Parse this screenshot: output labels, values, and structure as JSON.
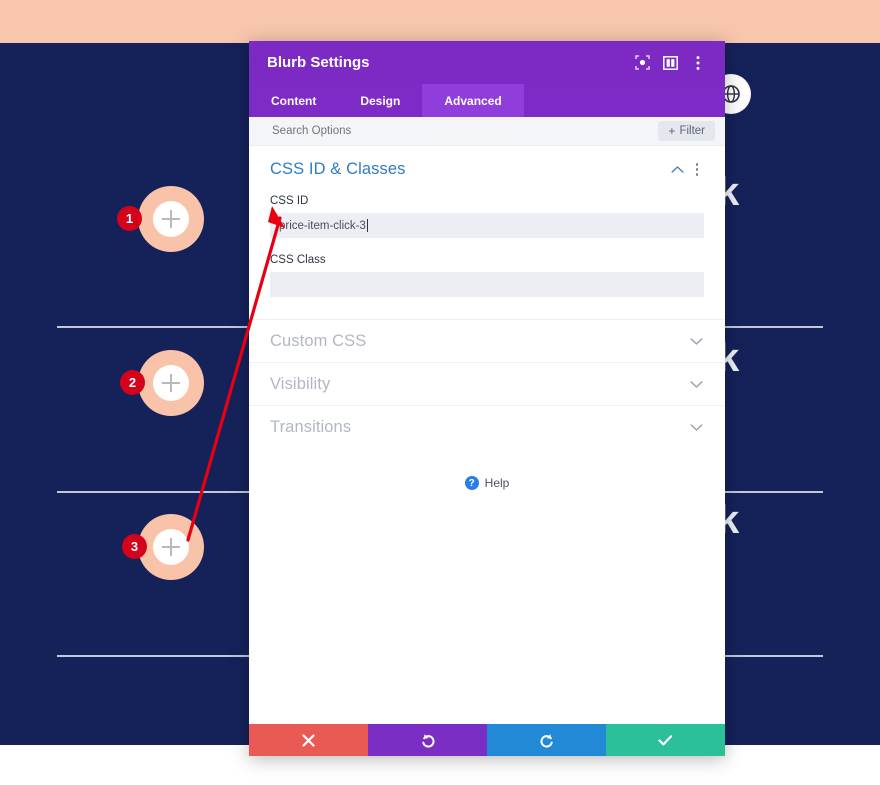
{
  "background": {
    "band_color": "#f7c6ad",
    "page_color": "#15225a",
    "globe_icon": "globe-icon",
    "blurbs": [
      {
        "number": "1",
        "icon": "plus-icon",
        "text_fragment": "k"
      },
      {
        "number": "2",
        "icon": "plus-icon",
        "text_fragment": "k"
      },
      {
        "number": "3",
        "icon": "plus-icon",
        "text_fragment": "k"
      }
    ]
  },
  "modal": {
    "title": "Blurb Settings",
    "header_icons": [
      {
        "name": "focus-target-icon"
      },
      {
        "name": "panel-layout-icon"
      },
      {
        "name": "more-options-icon"
      }
    ],
    "tabs": [
      {
        "label": "Content",
        "active": false
      },
      {
        "label": "Design",
        "active": false
      },
      {
        "label": "Advanced",
        "active": true
      }
    ],
    "search": {
      "placeholder": "Search Options",
      "value": ""
    },
    "filter_button": {
      "label": "Filter",
      "plus": "+"
    },
    "open_section": {
      "title": "CSS ID & Classes",
      "collapse_icon": "chevron-up-icon",
      "menu_icon": "more-options-icon",
      "fields": [
        {
          "label": "CSS ID",
          "value": "price-item-click-3",
          "focused": true
        },
        {
          "label": "CSS Class",
          "value": "",
          "focused": false
        }
      ]
    },
    "collapsed_sections": [
      {
        "title": "Custom CSS",
        "icon": "chevron-down-icon"
      },
      {
        "title": "Visibility",
        "icon": "chevron-down-icon"
      },
      {
        "title": "Transitions",
        "icon": "chevron-down-icon"
      }
    ],
    "help": {
      "icon": "question-mark-icon",
      "label": "Help"
    },
    "footer_buttons": [
      {
        "name": "cancel-button",
        "icon": "close-icon",
        "glyph": "✖",
        "color": "#ea5a55"
      },
      {
        "name": "undo-button",
        "icon": "undo-icon",
        "glyph": "↺",
        "color": "#7a2ec4"
      },
      {
        "name": "redo-button",
        "icon": "redo-icon",
        "glyph": "↻",
        "color": "#2189d6"
      },
      {
        "name": "save-button",
        "icon": "checkmark-icon",
        "glyph": "✔",
        "color": "#2bbf9a"
      }
    ]
  },
  "annotation": {
    "arrow_color": "#e60012",
    "points_from": "blurb-3-plus-icon",
    "points_to": "css-id-input"
  }
}
